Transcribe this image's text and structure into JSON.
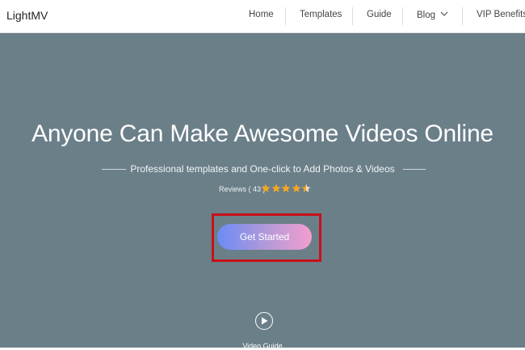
{
  "header": {
    "brand": "LightMV",
    "nav": [
      {
        "label": "Home"
      },
      {
        "label": "Templates"
      },
      {
        "label": "Guide"
      },
      {
        "label": "Blog"
      },
      {
        "label": "VIP Benefits"
      }
    ]
  },
  "hero": {
    "title": "Anyone Can Make Awesome Videos Online",
    "subtitle": "Professional templates and One-click to Add Photos & Videos",
    "reviews_label": "Reviews ( 43 )",
    "rating": 4.5,
    "rating_max": 5,
    "cta_label": "Get Started",
    "video_guide_label": "Video Guide"
  },
  "colors": {
    "hero_bg": "#6b7f89",
    "star": "#f5a623",
    "highlight": "#c8101a",
    "cta_gradient_start": "#6a8cf6",
    "cta_gradient_end": "#f29ed0"
  },
  "icons": [
    "chevron-down-icon",
    "star-icon",
    "play-icon"
  ]
}
